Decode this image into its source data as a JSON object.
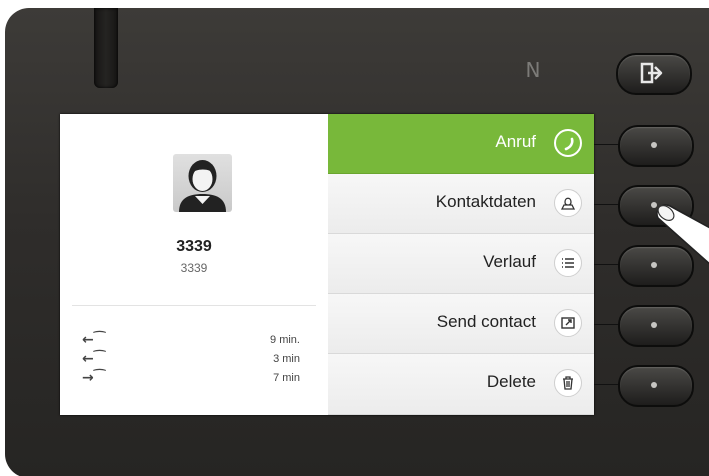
{
  "contact": {
    "name": "3339",
    "number": "3339",
    "calls": [
      {
        "direction": "incoming",
        "glyph": "←⁀",
        "duration": "9 min."
      },
      {
        "direction": "incoming",
        "glyph": "←⁀",
        "duration": "3 min"
      },
      {
        "direction": "outgoing",
        "glyph": "→⁀",
        "duration": "7 min"
      }
    ]
  },
  "menu": {
    "items": [
      {
        "label": "Anruf",
        "icon": "phone-handset-icon",
        "selected": true
      },
      {
        "label": "Kontaktdaten",
        "icon": "contact-person-icon",
        "selected": false
      },
      {
        "label": "Verlauf",
        "icon": "list-icon",
        "selected": false
      },
      {
        "label": "Send contact",
        "icon": "share-contact-icon",
        "selected": false
      },
      {
        "label": "Delete",
        "icon": "trash-icon",
        "selected": false
      }
    ]
  },
  "device": {
    "nfc_symbol": "N",
    "logout_icon": "logout-icon"
  },
  "colors": {
    "accent": "#78b83a",
    "bezel": "#2f2d2b",
    "menu_bg": "#f2f2f2"
  }
}
